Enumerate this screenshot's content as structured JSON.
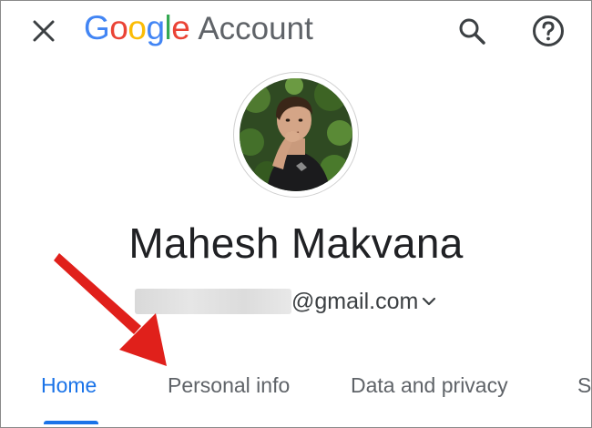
{
  "header": {
    "close_icon": "close-icon",
    "brand_letters": [
      "G",
      "o",
      "o",
      "g",
      "l",
      "e"
    ],
    "product": "Account",
    "search_icon": "search-icon",
    "help_icon": "help-icon"
  },
  "profile": {
    "name": "Mahesh Makvana",
    "email_domain": "@gmail.com",
    "avatar": "profile-photo"
  },
  "tabs": [
    {
      "label": "Home",
      "active": true
    },
    {
      "label": "Personal info",
      "active": false
    },
    {
      "label": "Data and privacy",
      "active": false
    },
    {
      "label": "S",
      "active": false
    }
  ],
  "colors": {
    "accent": "#1a73e8",
    "annotation_arrow": "#e0201b"
  }
}
